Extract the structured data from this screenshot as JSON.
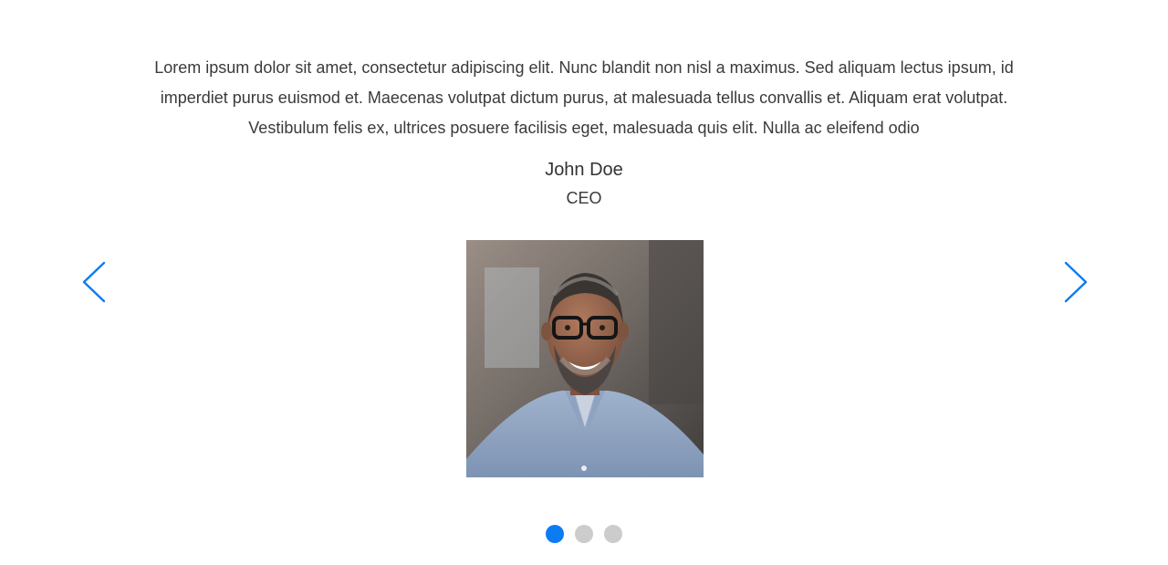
{
  "testimonial": {
    "quote": "Lorem ipsum dolor sit amet, consectetur adipiscing elit. Nunc blandit non nisl a maximus. Sed aliquam lectus ipsum, id imperdiet purus euismod et. Maecenas volutpat dictum purus, at malesuada tellus convallis et. Aliquam erat volutpat. Vestibulum felis ex, ultrices posuere facilisis eget, malesuada quis elit. Nulla ac eleifend odio",
    "name": "John Doe",
    "role": "CEO",
    "photo": "portrait-photo"
  },
  "navigation": {
    "prev_icon": "chevron-left-icon",
    "next_icon": "chevron-right-icon"
  },
  "pagination": {
    "total": 3,
    "active": 1
  },
  "colors": {
    "accent": "#0d7cf2",
    "inactive_dot": "#cccccc",
    "text": "#333333"
  }
}
